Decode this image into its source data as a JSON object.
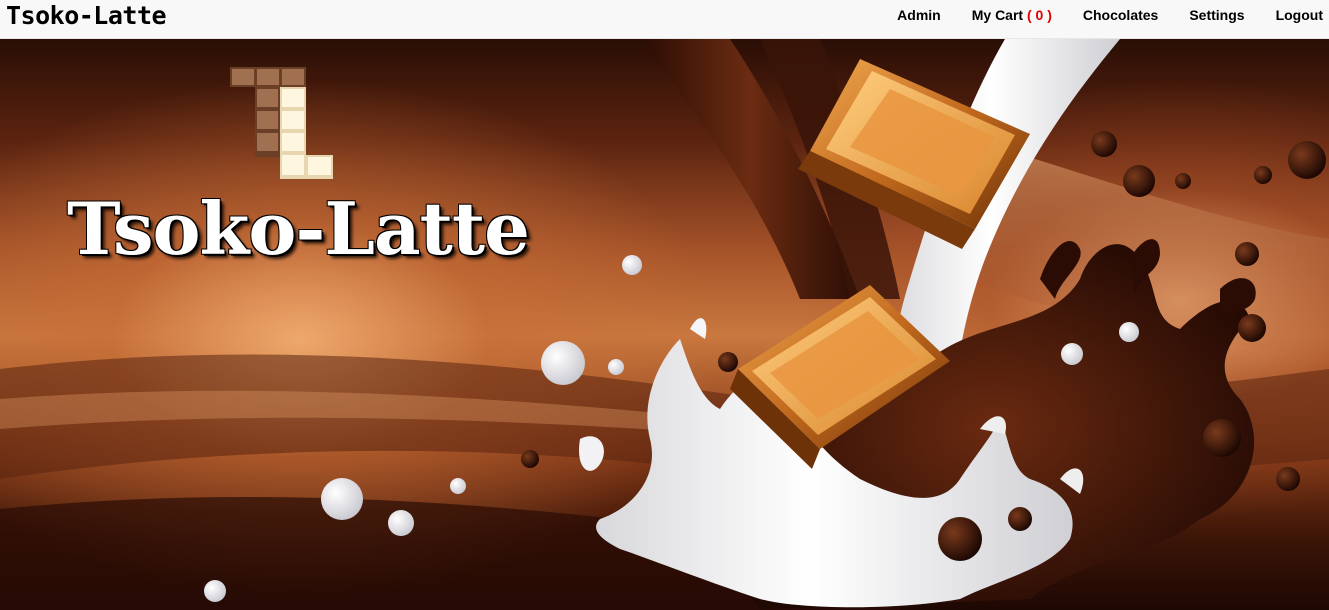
{
  "navbar": {
    "brand": "Tsoko-Latte",
    "links": {
      "admin": "Admin",
      "cart_label": "My Cart",
      "cart_count": "( 0 )",
      "chocolates": "Chocolates",
      "settings": "Settings",
      "logout": "Logout"
    }
  },
  "hero": {
    "logo_text": "Tsoko-Latte",
    "logo_icon": "chocolate-bar-logo-icon"
  },
  "colors": {
    "navbar_bg": "#f8f8f8",
    "cart_count": "#e00000",
    "milk_chocolate": "#8b5a3c",
    "white_chocolate": "#fdf3dc"
  }
}
